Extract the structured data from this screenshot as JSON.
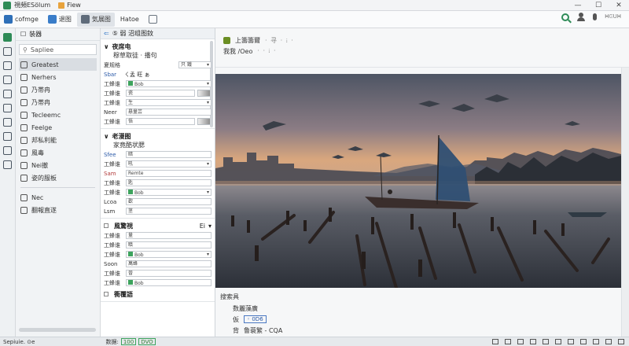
{
  "app": {
    "title": "視頻ESölum",
    "tab_label": "Fiew",
    "tab_icon_color": "#e8a33d"
  },
  "window": {
    "minimize": "—",
    "maximize": "☐",
    "close": "✕"
  },
  "toolbar": {
    "items": [
      {
        "label": "cofmge",
        "icon": "layers-icon",
        "color": "#2e6fb8"
      },
      {
        "label": "退图",
        "icon": "image-icon",
        "color": "#3a7dc9"
      },
      {
        "label": "気展图",
        "icon": "gallery-icon",
        "color": "#5f6b7a"
      },
      {
        "label": "Hatoe",
        "icon": "",
        "color": "#000000"
      },
      {
        "label": "",
        "icon": "grid-icon",
        "color": "#6b7580"
      }
    ],
    "active_index": 2,
    "right_text": "ᕼᕮᑌᕼ"
  },
  "nav": {
    "header": "装器",
    "search_placeholder": "Sapliee",
    "items": [
      {
        "label": "Greatest",
        "icon": "image-icon"
      },
      {
        "label": "Nerhers",
        "icon": "folder-icon"
      },
      {
        "label": "乃帯冉",
        "icon": "tag-icon"
      },
      {
        "label": "乃帯冉",
        "icon": "clock-icon"
      },
      {
        "label": "Tecleemc",
        "icon": "camera-icon"
      },
      {
        "label": "Feelge",
        "icon": "doc-icon"
      },
      {
        "label": "邦私利能",
        "icon": "share-icon"
      },
      {
        "label": "風毒",
        "icon": "box-icon"
      },
      {
        "label": "Nei撤",
        "icon": "trash-icon"
      },
      {
        "label": "姿的服板",
        "icon": "gear-icon"
      }
    ],
    "selected_index": 0,
    "footer_items": [
      {
        "label": "Nec",
        "icon": "check-icon"
      },
      {
        "label": "翻報直遂",
        "icon": "link-icon"
      }
    ]
  },
  "props": {
    "header": "⑤ 弱 沼组图鈫",
    "section1": {
      "title": "夜席电",
      "sub": "穆草取徒 · 播句",
      "label2": "夏规格",
      "value2": "只 鐵",
      "row3_label": "Sbar",
      "row3_text": "ㄑ孟 旺 ぁ",
      "rows": [
        {
          "label": "工蜂谁",
          "value": "Bob"
        },
        {
          "label": "工蜂谁",
          "value": "瓷"
        },
        {
          "label": "工蜂谁",
          "value": "生"
        },
        {
          "label": "Neer",
          "value": "悬量芸"
        },
        {
          "label": "工蜂谁",
          "value": "悟"
        }
      ]
    },
    "section2": {
      "title": "老漫图",
      "sub": "家竟酷状腮",
      "rows": [
        {
          "label": "Sfee",
          "value": "暗"
        },
        {
          "label": "工蜂谁",
          "value": "吼"
        },
        {
          "label": "Sam",
          "value": "Remte"
        },
        {
          "label": "工蜂谁",
          "value": "匙"
        },
        {
          "label": "工蜂谁",
          "value": "Bob"
        },
        {
          "label": "Lcoa",
          "value": "歡"
        },
        {
          "label": "Lsm",
          "value": "茎"
        }
      ]
    },
    "section3": {
      "title": "風驚視",
      "value": "Ei",
      "rows": [
        {
          "label": "工蜂谁",
          "value": "量"
        },
        {
          "label": "工蜂谁",
          "value": "瞋"
        },
        {
          "label": "工蜂谁",
          "value": "Bob"
        },
        {
          "label": "Soon",
          "value": "萬蜂"
        },
        {
          "label": "工蜂谁",
          "value": "晉"
        },
        {
          "label": "工蜂谁",
          "value": "Bob"
        }
      ],
      "footer": "衝覆語"
    }
  },
  "viewer": {
    "line1": "上籌籌爾",
    "line1_blur": "· 寻 · ፧ ·",
    "line2": "我我 /Oeo",
    "line2_blur": "· · ፧ ·",
    "caption_title": "搜索具",
    "caption_sub": "数麗藻廣",
    "caption_row1_label": "仮",
    "caption_row1_badge": "◦ 0D6",
    "caption_row2_label": "背",
    "caption_row2_text": "鲁蓑繁 - CQA"
  },
  "statusbar": {
    "left": "Sepiuie. ⊙e",
    "zoom_label": "数据:",
    "zoom_box1": "100",
    "zoom_box2": "DVO",
    "icons": [
      "grid-icon",
      "list-icon",
      "clock-icon",
      "image-icon",
      "bell-icon",
      "zoom-icon",
      "cloud-icon",
      "share-icon",
      "view-icon",
      "settings-icon",
      "info-icon"
    ]
  },
  "colors": {
    "accent": "#2e8b57",
    "sky_top": "#4e5564",
    "sky_mid": "#8b7c84",
    "horizon": "#d9a77e",
    "water": "#3c4048",
    "sail": "#2f4f73"
  }
}
